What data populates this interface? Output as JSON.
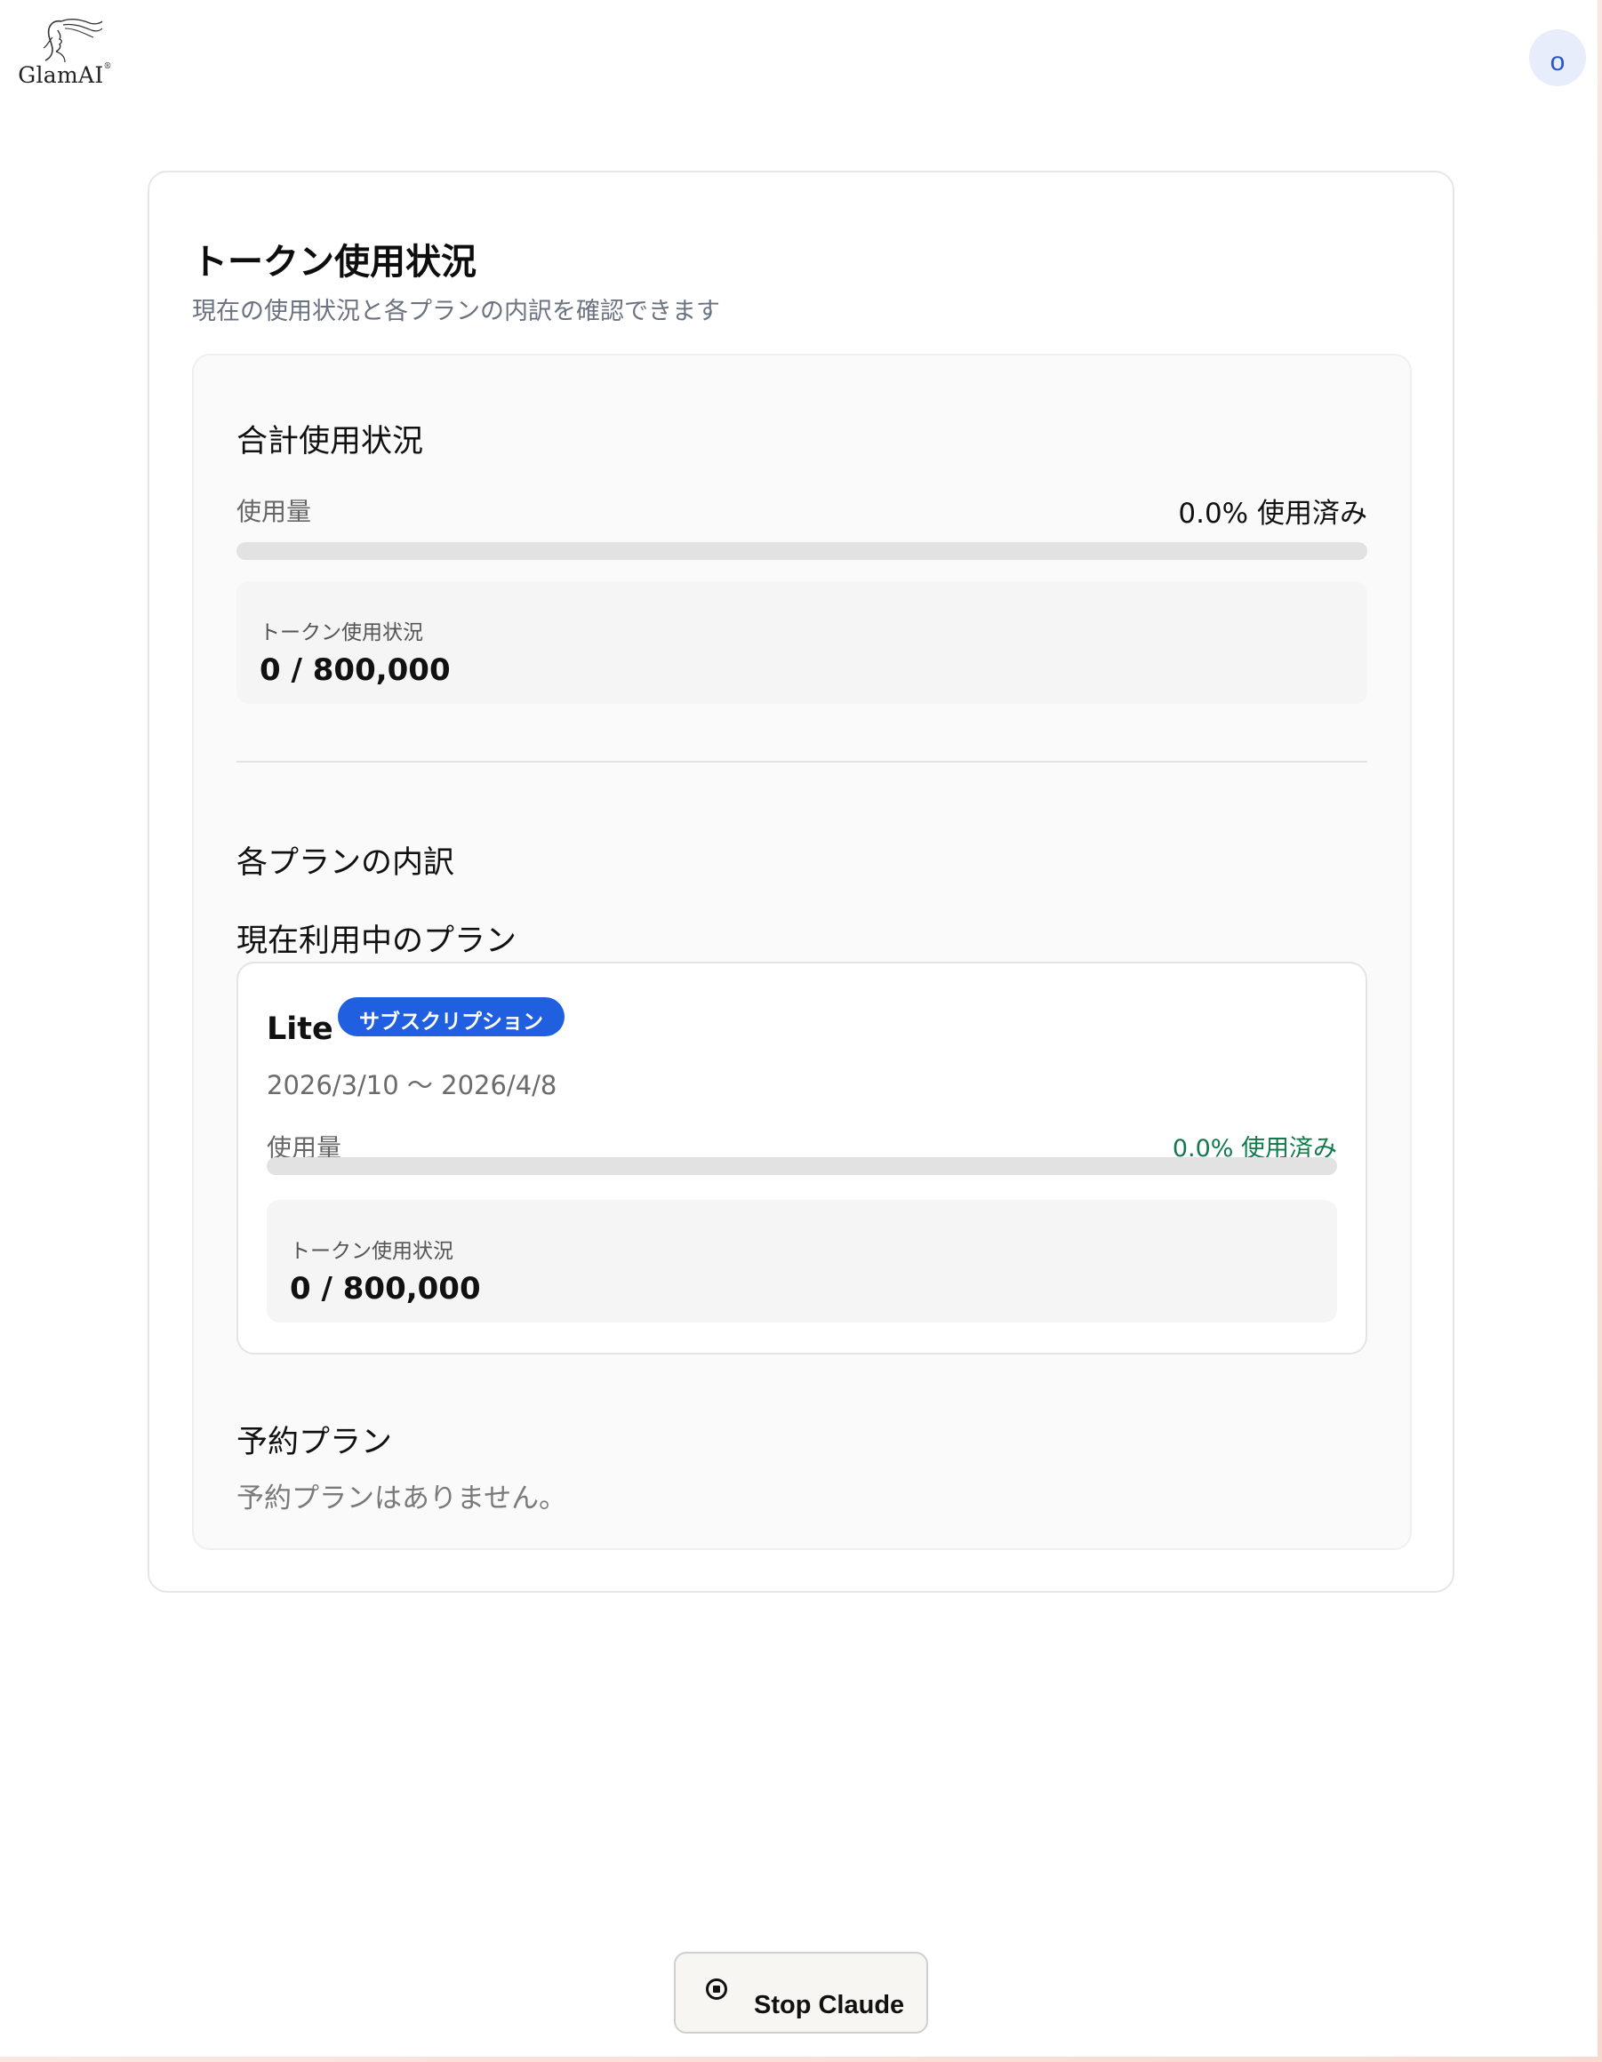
{
  "header": {
    "logo_text": "GlamAI",
    "logo_mark": "®",
    "avatar_initial": "o"
  },
  "page": {
    "title": "トークン使用状況",
    "subtitle": "現在の使用状況と各プランの内訳を確認できます"
  },
  "total": {
    "section_title": "合計使用状況",
    "usage_label": "使用量",
    "usage_percent": "0.0% 使用済み",
    "usage_fraction": 0.0,
    "token_label": "トークン使用状況",
    "token_value": "0 / 800,000"
  },
  "breakdown": {
    "section_title": "各プランの内訳",
    "current_title": "現在利用中のプラン",
    "current_plan": {
      "name": "Lite",
      "badge": "サブスクリプション",
      "dates": "2026/3/10 〜 2026/4/8",
      "usage_label": "使用量",
      "usage_percent": "0.0% 使用済み",
      "usage_fraction": 0.0,
      "token_label": "トークン使用状況",
      "token_value": "0 / 800,000"
    },
    "reserved_title": "予約プラン",
    "reserved_empty": "予約プランはありません。"
  },
  "footer": {
    "stop_label": "Stop Claude",
    "stop_icon": "stop-circle-icon"
  },
  "colors": {
    "accent": "#1f5fe0",
    "success": "#0f7a4a",
    "avatar_bg": "#e7edfb"
  }
}
